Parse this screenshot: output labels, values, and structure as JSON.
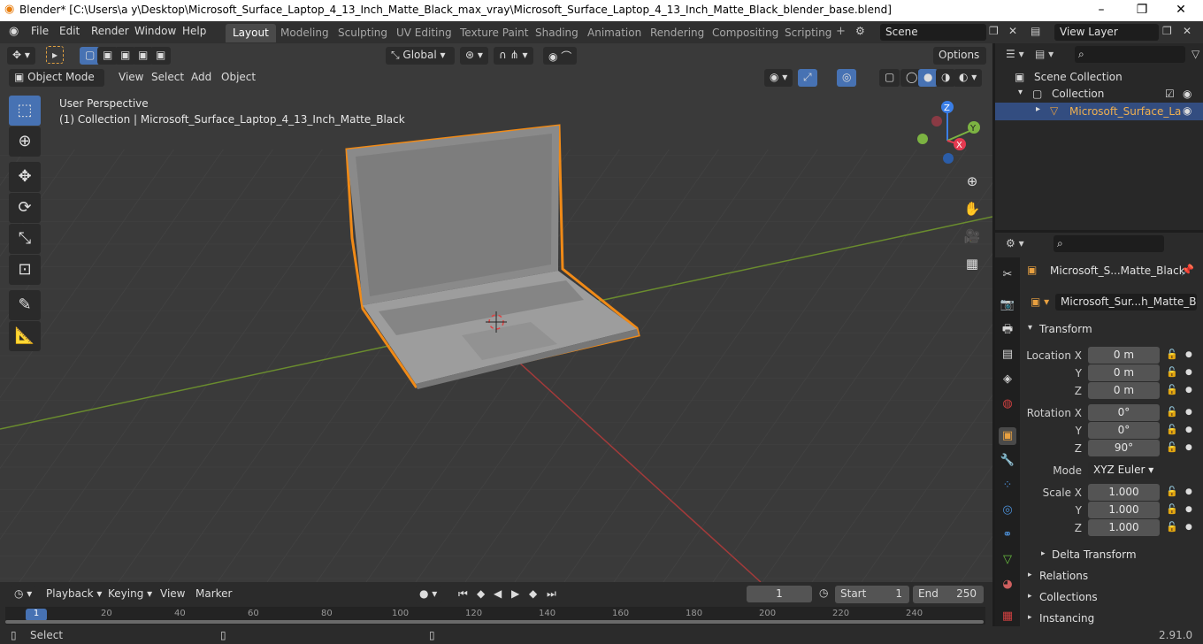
{
  "window": {
    "title": "Blender* [C:\\Users\\a y\\Desktop\\Microsoft_Surface_Laptop_4_13_Inch_Matte_Black_max_vray\\Microsoft_Surface_Laptop_4_13_Inch_Matte_Black_blender_base.blend]",
    "minimize": "–",
    "maximize": "❐",
    "close": "✕"
  },
  "menu": {
    "items": [
      "File",
      "Edit",
      "Render",
      "Window",
      "Help"
    ]
  },
  "workspaces": [
    "Layout",
    "Modeling",
    "Sculpting",
    "UV Editing",
    "Texture Paint",
    "Shading",
    "Animation",
    "Rendering",
    "Compositing",
    "Scripting"
  ],
  "scene": {
    "name": "Scene"
  },
  "view_layer": {
    "name": "View Layer"
  },
  "viewport_header": {
    "transform_orientation": "Global",
    "options": "Options",
    "mode": "Object Mode",
    "menus": [
      "View",
      "Select",
      "Add",
      "Object"
    ]
  },
  "viewport": {
    "perspective": "User Perspective",
    "collection_info": "(1) Collection | Microsoft_Surface_Laptop_4_13_Inch_Matte_Black",
    "gizmo": {
      "x": "X",
      "y": "Y",
      "z": "Z"
    }
  },
  "outliner": {
    "search_placeholder": "",
    "scene_collection": "Scene Collection",
    "collection": "Collection",
    "object": "Microsoft_Surface_La"
  },
  "properties": {
    "object_name": "Microsoft_S...Matte_Black",
    "data_name": "Microsoft_Sur...h_Matte_Black",
    "transform_title": "Transform",
    "location_label": "Location X",
    "rotation_label": "Rotation X",
    "scale_label": "Scale X",
    "y_label": "Y",
    "z_label": "Z",
    "location": [
      "0 m",
      "0 m",
      "0 m"
    ],
    "rotation": [
      "0°",
      "0°",
      "90°"
    ],
    "mode_label": "Mode",
    "mode_value": "XYZ Euler",
    "scale": [
      "1.000",
      "1.000",
      "1.000"
    ],
    "delta_transform": "Delta Transform",
    "relations": "Relations",
    "collections": "Collections",
    "instancing": "Instancing"
  },
  "timeline": {
    "menus": [
      "Playback",
      "Keying",
      "View",
      "Marker"
    ],
    "current_frame": "1",
    "start_label": "Start",
    "start": "1",
    "end_label": "End",
    "end": "250",
    "ruler": [
      "1",
      "20",
      "40",
      "60",
      "80",
      "100",
      "120",
      "140",
      "160",
      "180",
      "200",
      "220",
      "240"
    ]
  },
  "status": {
    "left": "Select",
    "version": "2.91.0"
  }
}
